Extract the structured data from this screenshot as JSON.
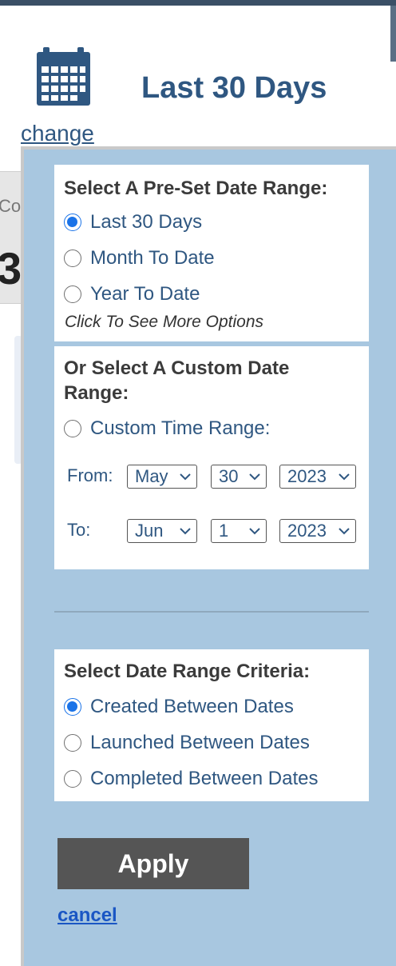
{
  "header": {
    "range_title": "Last 30 Days",
    "change_link": "change",
    "calendar_icon": "calendar-icon"
  },
  "background": {
    "partial_text_small": "Co",
    "partial_text_big": "3"
  },
  "preset": {
    "heading": "Select A Pre-Set Date Range:",
    "options": [
      {
        "label": "Last 30 Days",
        "checked": true
      },
      {
        "label": "Month To Date",
        "checked": false
      },
      {
        "label": "Year To Date",
        "checked": false
      }
    ],
    "more_options_note": "Click To See More Options"
  },
  "custom": {
    "heading_line1": "Or Select A Custom Date",
    "heading_line2": "Range:",
    "option_label": "Custom Time Range:",
    "checked": false,
    "from_label": "From:",
    "to_label": "To:",
    "from": {
      "month": "May",
      "day": "30",
      "year": "2023"
    },
    "to": {
      "month": "Jun",
      "day": "1",
      "year": "2023"
    }
  },
  "criteria": {
    "heading": "Select Date Range Criteria:",
    "options": [
      {
        "label": "Created Between Dates",
        "checked": true
      },
      {
        "label": "Launched Between Dates",
        "checked": false
      },
      {
        "label": "Completed Between Dates",
        "checked": false
      }
    ]
  },
  "actions": {
    "apply_label": "Apply",
    "cancel_label": "cancel"
  },
  "colors": {
    "panel_bg": "#a8c7e0",
    "accent_blue": "#2f5781",
    "radio_checked": "#1a73e8",
    "apply_bg": "#555555"
  }
}
